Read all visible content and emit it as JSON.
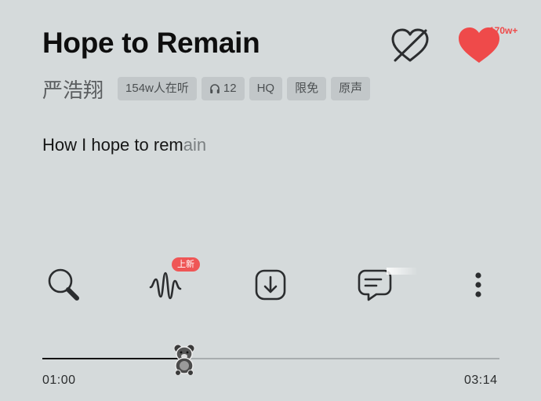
{
  "song": {
    "title": "Hope to Remain",
    "artist": "严浩翔",
    "like_count": "170w+"
  },
  "tags": {
    "listeners": "154w人在听",
    "headphones": "12",
    "quality": "HQ",
    "free": "限免",
    "original": "原声"
  },
  "lyric": {
    "sung": "How I hope to rem",
    "upcoming": "ain"
  },
  "toolbar": {
    "sound_effect_badge": "上新"
  },
  "player": {
    "current_time": "01:00",
    "duration": "03:14",
    "progress": 0.31
  },
  "colors": {
    "background": "#d5dadb",
    "like": "#ef4a4a",
    "badge": "#ef5656",
    "tag_bg": "#c2c7c9"
  },
  "icons": {
    "unlike": "heart-slash-icon",
    "like": "heart-icon",
    "search": "search-icon",
    "sound_effect": "sound-wave-icon",
    "download": "download-icon",
    "comment": "comment-icon",
    "more": "more-vertical-icon",
    "headphones": "headphones-icon",
    "thumb": "teddy-bear-icon"
  }
}
